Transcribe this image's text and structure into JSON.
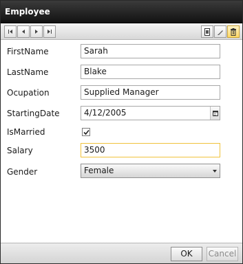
{
  "window": {
    "title": "Employee"
  },
  "toolbar": {
    "nav": [
      {
        "name": "first-record-button",
        "icon": "first-icon"
      },
      {
        "name": "previous-record-button",
        "icon": "previous-icon"
      },
      {
        "name": "next-record-button",
        "icon": "next-icon"
      },
      {
        "name": "last-record-button",
        "icon": "last-icon"
      }
    ],
    "actions": [
      {
        "name": "new-record-button",
        "icon": "new-document-icon"
      },
      {
        "name": "edit-record-button",
        "icon": "pencil-icon"
      },
      {
        "name": "delete-record-button",
        "icon": "trash-icon",
        "selected": true
      }
    ]
  },
  "form": {
    "first_name": {
      "label": "FirstName",
      "value": "Sarah"
    },
    "last_name": {
      "label": "LastName",
      "value": "Blake"
    },
    "occupation": {
      "label": "Ocupation",
      "value": "Supplied Manager"
    },
    "starting_date": {
      "label": "StartingDate",
      "value": "4/12/2005"
    },
    "is_married": {
      "label": "IsMarried",
      "checked": true
    },
    "salary": {
      "label": "Salary",
      "value": "3500"
    },
    "gender": {
      "label": "Gender",
      "value": "Female"
    }
  },
  "footer": {
    "ok_label": "OK",
    "cancel_label": "Cancel"
  },
  "colors": {
    "titlebar": "#1e1e1e",
    "focus_border": "#f0c23a",
    "selected_button": "#ffd867"
  }
}
